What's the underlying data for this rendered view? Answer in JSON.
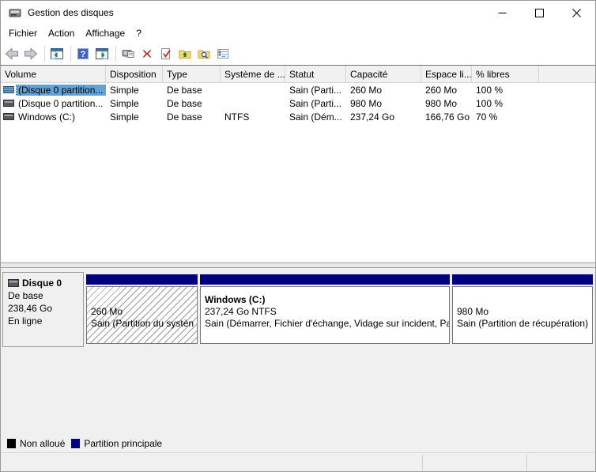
{
  "window": {
    "title": "Gestion des disques"
  },
  "menu": {
    "fichier": "Fichier",
    "action": "Action",
    "affichage": "Affichage",
    "help": "?"
  },
  "toolbar": {
    "icons": [
      "back",
      "forward",
      "console-tree-window",
      "help",
      "detail-pane-window",
      "popup-menu",
      "delete-x",
      "document-check",
      "folder-up-arrow",
      "folder-magnifier",
      "checklist"
    ]
  },
  "table": {
    "columns": {
      "volume": "Volume",
      "disposition": "Disposition",
      "type": "Type",
      "systeme": "Système de ...",
      "statut": "Statut",
      "capacite": "Capacité",
      "espace": "Espace li...",
      "libres": "% libres"
    },
    "rows": [
      {
        "volume": "(Disque 0 partition...",
        "disposition": "Simple",
        "type": "De base",
        "systeme": "",
        "statut": "Sain (Parti...",
        "capacite": "260 Mo",
        "espace": "260 Mo",
        "libres": "100 %"
      },
      {
        "volume": "(Disque 0 partition...",
        "disposition": "Simple",
        "type": "De base",
        "systeme": "",
        "statut": "Sain (Parti...",
        "capacite": "980 Mo",
        "espace": "980 Mo",
        "libres": "100 %"
      },
      {
        "volume": "Windows (C:)",
        "disposition": "Simple",
        "type": "De base",
        "systeme": "NTFS",
        "statut": "Sain (Dém...",
        "capacite": "237,24 Go",
        "espace": "166,76 Go",
        "libres": "70 %"
      }
    ]
  },
  "disk": {
    "name": "Disque 0",
    "type": "De base",
    "size": "238,46 Go",
    "status": "En ligne",
    "partitions": [
      {
        "size": "260 Mo",
        "status": "Sain (Partition du systèn"
      },
      {
        "name": "Windows  (C:)",
        "size": "237,24 Go NTFS",
        "status": "Sain (Démarrer, Fichier d'échange, Vidage sur incident, Pa"
      },
      {
        "size": "980 Mo",
        "status": "Sain (Partition de récupération)"
      }
    ]
  },
  "legend": {
    "unallocated": "Non alloué",
    "primary": "Partition principale",
    "colors": {
      "unallocated": "#000000",
      "primary": "#000080"
    }
  },
  "colors": {
    "partition_bar": "#000080",
    "selection": "#5fa3d9"
  }
}
